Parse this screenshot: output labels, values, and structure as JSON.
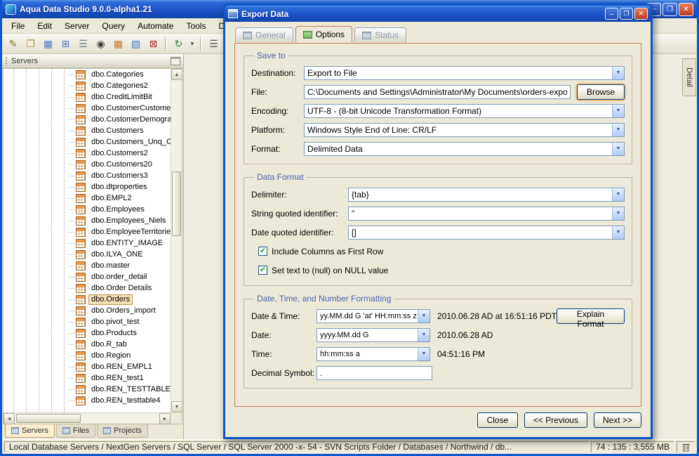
{
  "colors": {
    "titlebar_blue": "#1A50C4",
    "content_border_orange": "#C87E4F",
    "group_title_blue": "#4C63B0",
    "selection_tan": "#F1DFB6",
    "check_green": "#21A121",
    "close_button_red": "#C23818"
  },
  "scrollbar": {
    "up": "▲",
    "down": "▼",
    "left": "◄",
    "right": "►"
  },
  "window_controls": [
    {
      "name": "minimize-button",
      "glyph": "─"
    },
    {
      "name": "maximize-button",
      "glyph": "❐"
    },
    {
      "name": "close-button",
      "glyph": "✕",
      "cls": "close"
    }
  ],
  "main_window": {
    "title": "Aqua Data Studio 9.0.0-alpha1.21",
    "menus": [
      "File",
      "Edit",
      "Server",
      "Query",
      "Automate",
      "Tools",
      "DBA Tools"
    ],
    "toolbar": {
      "icons": [
        {
          "name": "new-query-icon",
          "glyph": "✎",
          "color": "#8A6D1C"
        },
        {
          "name": "open-file-icon",
          "glyph": "❐",
          "color": "#B8912A"
        },
        {
          "name": "schema-browser-icon",
          "glyph": "▦",
          "color": "#4878C8"
        },
        {
          "name": "windows-icon",
          "glyph": "⊞",
          "color": "#4878C8"
        },
        {
          "name": "server-registration-icon",
          "glyph": "☰",
          "color": "#6A7A8A"
        },
        {
          "name": "find-icon",
          "glyph": "◉",
          "color": "#444444"
        },
        {
          "name": "new-table-icon",
          "glyph": "▦",
          "color": "#C87828"
        },
        {
          "name": "alter-table-icon",
          "glyph": "▧",
          "color": "#4878C8"
        },
        {
          "name": "drop-table-icon",
          "glyph": "⊠",
          "color": "#B03020"
        },
        {
          "cls": "sep"
        },
        {
          "name": "refresh-icon",
          "glyph": "↻",
          "color": "#2A7A2A"
        },
        {
          "name": "history-dropdown-icon",
          "glyph": "▾",
          "color": "#444444",
          "cls": "narrow"
        },
        {
          "cls": "sep"
        },
        {
          "name": "text-results-icon",
          "glyph": "☰",
          "color": "#555555"
        },
        {
          "name": "grid-results-icon",
          "glyph": "▦",
          "color": "#4878C8",
          "cls": "pressed"
        },
        {
          "name": "pivot-results-icon",
          "glyph": "▤",
          "color": "#4878C8"
        }
      ]
    },
    "servers_panel": {
      "title": "Servers",
      "tree_items": [
        "dbo.Categories",
        "dbo.Categories2",
        "dbo.CreditLimitBit",
        "dbo.CustomerCustomerD",
        "dbo.CustomerDemograpl",
        "dbo.Customers",
        "dbo.Customers_Unq_Cns",
        "dbo.Customers2",
        "dbo.Customers20",
        "dbo.Customers3",
        "dbo.dtproperties",
        "dbo.EMPL2",
        "dbo.Employees",
        "dbo.Employees_Niels",
        "dbo.EmployeeTerritories",
        "dbo.ENTITY_IMAGE",
        "dbo.ILYA_ONE",
        "dbo.master",
        "dbo.order_detail",
        "dbo.Order Details",
        "dbo.Orders",
        "dbo.Orders_import",
        "dbo.pivot_test",
        "dbo.Products",
        "dbo.R_tab",
        "dbo.Region",
        "dbo.REN_EMPL1",
        "dbo.REN_test1",
        "dbo.REN_TESTTABLE",
        "dbo.REN_testtable4"
      ],
      "selected_index": 20,
      "bottom_tabs": [
        {
          "label": "Servers",
          "cls": "active"
        },
        {
          "label": "Files"
        },
        {
          "label": "Projects"
        }
      ]
    },
    "detail_tab_label": "Detail",
    "status_bar": {
      "path": "Local Database Servers / NextGen Servers / SQL Server / SQL Server 2000 -x- 54 - SVN Scripts Folder / Databases / Northwind / db...",
      "stats": "74 : 135 : 3,555 MB"
    }
  },
  "dialog": {
    "title": "Export Data",
    "tabs": [
      {
        "label": "General",
        "cls": "disabled"
      },
      {
        "label": "Options",
        "cls": "active"
      },
      {
        "label": "Status",
        "cls": "disabled"
      }
    ],
    "save_to": {
      "title": "Save to",
      "destination_label": "Destination:",
      "destination_value": "Export to File",
      "file_label": "File:",
      "file_value": "C:\\Documents and Settings\\Administrator\\My Documents\\orders-export.txt",
      "browse_label": "Browse",
      "encoding_label": "Encoding:",
      "encoding_value": "UTF-8 - (8-bit Unicode Transformation Format)",
      "platform_label": "Platform:",
      "platform_value": "Windows Style End of Line: CR/LF",
      "format_label": "Format:",
      "format_value": "Delimited Data"
    },
    "data_format": {
      "title": "Data Format",
      "delimiter_label": "Delimiter:",
      "delimiter_value": "{tab}",
      "string_quote_label": "String quoted identifier:",
      "string_quote_value": "\"",
      "date_quote_label": "Date quoted identifier:",
      "date_quote_value": "[]",
      "checkbox_columns_label": "Include Columns as First Row",
      "checkbox_columns_checked": true,
      "checkbox_null_label": "Set text to (null) on NULL value",
      "checkbox_null_checked": true,
      "check_glyph": "✔"
    },
    "datetime_format": {
      "title": "Date, Time, and Number Formatting",
      "datetime_label": "Date & Time:",
      "datetime_pattern": "yy.MM.dd G 'at' HH:mm:ss z",
      "datetime_preview": "2010.06.28 AD at 16:51:16 PDT",
      "explain_label": "Explain Format",
      "date_label": "Date:",
      "date_pattern": "yyyy.MM.dd G",
      "date_preview": "2010.06.28 AD",
      "time_label": "Time:",
      "time_pattern": "hh:mm:ss a",
      "time_preview": "04:51:16 PM",
      "decimal_label": "Decimal Symbol:",
      "decimal_value": "."
    },
    "buttons": {
      "close": "Close",
      "previous": "<< Previous",
      "next": "Next >>"
    }
  }
}
